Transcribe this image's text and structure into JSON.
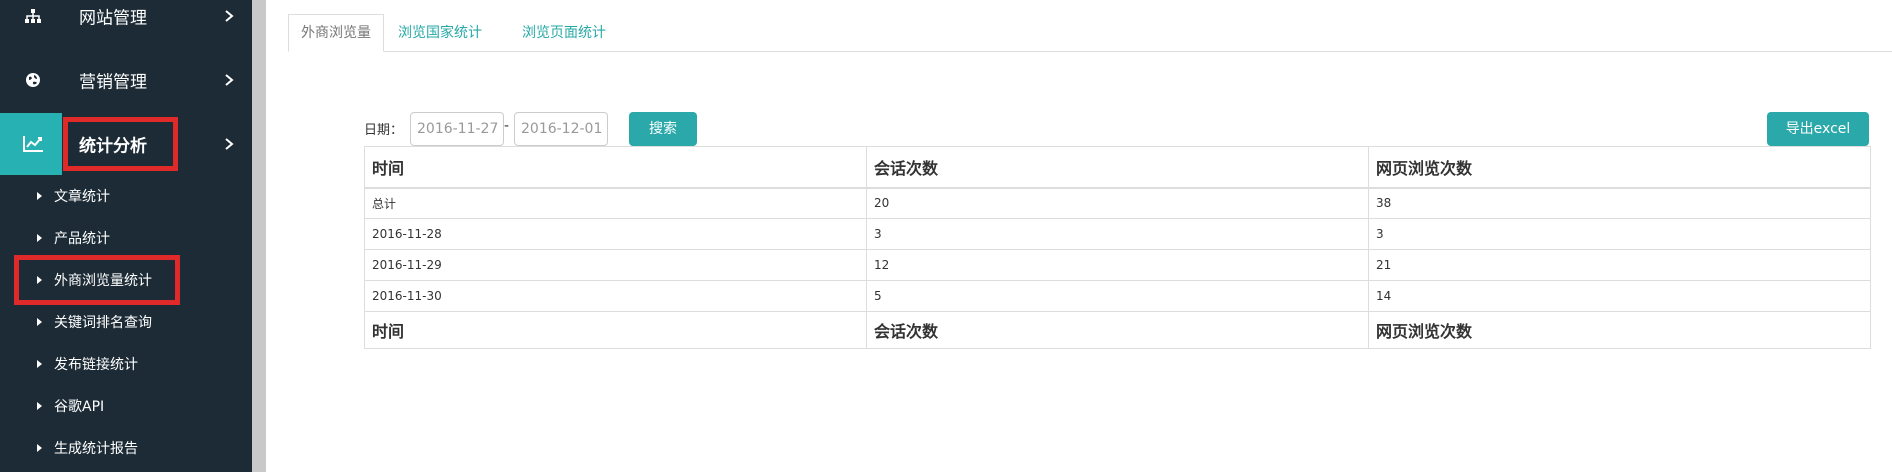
{
  "sidebar": {
    "main_items": [
      {
        "label": "网站管理",
        "icon": "sitemap-icon"
      },
      {
        "label": "营销管理",
        "icon": "globe-icon"
      },
      {
        "label": "统计分析",
        "icon": "line-chart-icon"
      }
    ],
    "sub_items": [
      {
        "label": "文章统计"
      },
      {
        "label": "产品统计"
      },
      {
        "label": "外商浏览量统计"
      },
      {
        "label": "关键词排名查询"
      },
      {
        "label": "发布链接统计"
      },
      {
        "label": "谷歌API"
      },
      {
        "label": "生成统计报告"
      }
    ]
  },
  "tabs": [
    {
      "label": "外商浏览量"
    },
    {
      "label": "浏览国家统计"
    },
    {
      "label": "浏览页面统计"
    }
  ],
  "filter": {
    "date_label": "日期：",
    "start_date": "2016-11-27",
    "separator": "-",
    "end_date": "2016-12-01",
    "search_label": "搜索",
    "export_label": "导出excel"
  },
  "table": {
    "headers": [
      "时间",
      "会话次数",
      "网页浏览次数"
    ],
    "rows": [
      [
        "总计",
        "20",
        "38"
      ],
      [
        "2016-11-28",
        "3",
        "3"
      ],
      [
        "2016-11-29",
        "12",
        "21"
      ],
      [
        "2016-11-30",
        "5",
        "14"
      ]
    ],
    "footer": [
      "时间",
      "会话次数",
      "网页浏览次数"
    ]
  },
  "colors": {
    "sidebar_bg": "#1c2b36",
    "accent": "#27b1b3",
    "highlight_box": "#e02a2a",
    "tab_link": "#27a9a7"
  }
}
